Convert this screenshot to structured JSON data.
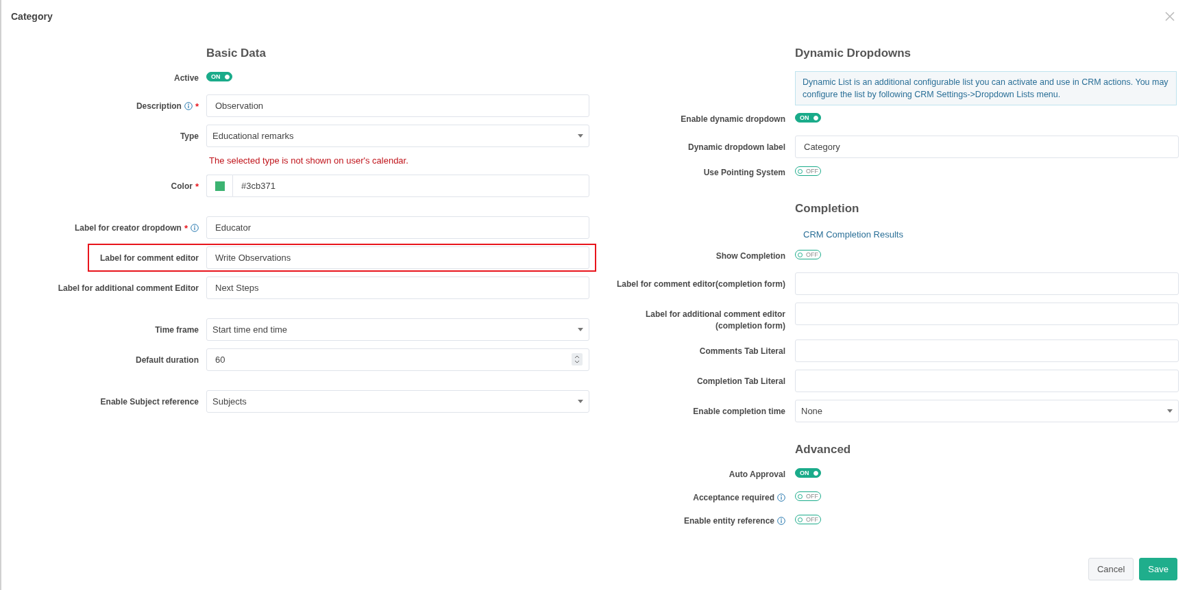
{
  "dialog": {
    "title": "Category"
  },
  "left": {
    "heading": "Basic Data",
    "groups": [
      [
        {
          "kind": "toggle",
          "label": "Active",
          "on": true,
          "text": "ON",
          "highlighted": false
        },
        {
          "kind": "input",
          "label": "Description",
          "marks": [
            {
              "kind": "info"
            },
            {
              "kind": "required",
              "text": "*"
            }
          ],
          "value": "Observation",
          "highlighted": false
        },
        {
          "kind": "select",
          "label": "Type",
          "value": "Educational remarks",
          "error": "The selected type is not shown on user's calendar.",
          "highlighted": false
        },
        {
          "kind": "color",
          "label": "Color",
          "marks": [
            {
              "kind": "required",
              "text": "*"
            }
          ],
          "value": "#3cb371",
          "color": "#3cb371",
          "highlighted": false
        }
      ],
      [
        {
          "kind": "input",
          "label": "Label for creator dropdown",
          "marks": [
            {
              "kind": "required",
              "text": "*"
            },
            {
              "kind": "info"
            }
          ],
          "value": "Educator",
          "highlighted": false
        },
        {
          "kind": "input",
          "label": "Label for comment editor",
          "value": "Write Observations",
          "highlighted": true
        },
        {
          "kind": "input",
          "label": "Label for additional comment Editor",
          "value": "Next Steps",
          "highlighted": false
        }
      ],
      [
        {
          "kind": "select",
          "label": "Time frame",
          "value": "Start time end time",
          "highlighted": false
        },
        {
          "kind": "number",
          "label": "Default duration",
          "value": "60",
          "highlighted": false
        }
      ],
      [
        {
          "kind": "select",
          "label": "Enable Subject reference",
          "value": "Subjects",
          "highlighted": false
        }
      ]
    ]
  },
  "right": {
    "sections": [
      {
        "heading": "Dynamic Dropdowns",
        "note": "Dynamic List is an additional configurable list you can activate and use in CRM actions. You may configure the list by following CRM Settings->Dropdown Lists menu.",
        "rows": [
          {
            "kind": "toggle",
            "label": "Enable dynamic dropdown",
            "on": true,
            "text": "ON"
          },
          {
            "kind": "input",
            "label": "Dynamic dropdown label",
            "value": "Category"
          },
          {
            "kind": "toggle",
            "label": "Use Pointing System",
            "on": false,
            "text": "OFF"
          }
        ]
      },
      {
        "heading": "Completion",
        "link": "CRM Completion Results",
        "rows": [
          {
            "kind": "toggle",
            "label": "Show Completion",
            "on": false,
            "text": "OFF"
          },
          {
            "kind": "input",
            "label": "Label for comment editor(completion form)"
          },
          {
            "kind": "input",
            "label": "Label for additional comment editor (completion form)"
          },
          {
            "kind": "input",
            "label": "Comments Tab Literal"
          },
          {
            "kind": "input",
            "label": "Completion Tab Literal"
          },
          {
            "kind": "select",
            "label": "Enable completion time",
            "value": "None"
          }
        ]
      },
      {
        "heading": "Advanced",
        "rows": [
          {
            "kind": "toggle",
            "label": "Auto Approval",
            "on": true,
            "text": "ON"
          },
          {
            "kind": "toggle",
            "label": "Acceptance required",
            "marks": [
              {
                "kind": "info"
              }
            ],
            "on": false,
            "text": "OFF"
          },
          {
            "kind": "toggle",
            "label": "Enable entity reference",
            "marks": [
              {
                "kind": "info"
              }
            ],
            "on": false,
            "text": "OFF"
          }
        ]
      }
    ]
  },
  "buttons": [
    {
      "label": "Cancel",
      "kind": "secondary"
    },
    {
      "label": "Save",
      "kind": "primary"
    }
  ]
}
